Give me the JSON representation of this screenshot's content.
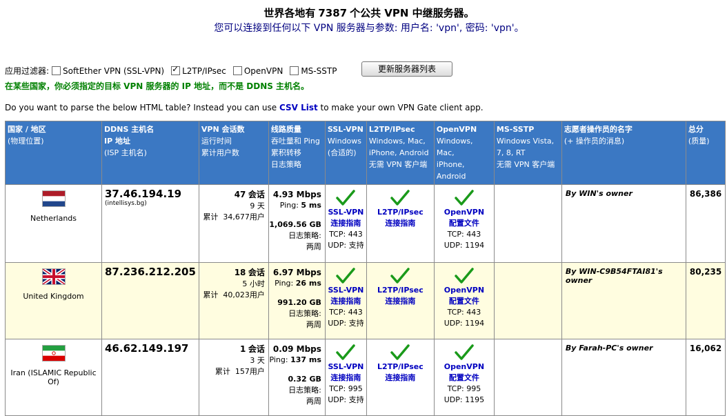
{
  "header": {
    "line1_pre": "世界各地有",
    "count": "7387",
    "line1_post": "个公共 VPN 中继服务器。",
    "line2_pre": "您可以连接到任何以下 VPN 服务器与参数: 用户名:",
    "user": "'vpn'",
    "line2_mid": ", 密码:",
    "pass": "'vpn'",
    "line2_end": "。"
  },
  "filters": {
    "label": "应用过滤器:",
    "options": [
      {
        "label": "SoftEther VPN (SSL-VPN)",
        "checked": false
      },
      {
        "label": "L2TP/IPsec",
        "checked": true
      },
      {
        "label": "OpenVPN",
        "checked": false
      },
      {
        "label": "MS-SSTP",
        "checked": false
      }
    ],
    "refresh_label": "更新服务器列表"
  },
  "warning": "在某些国家，你必须指定的目标 VPN 服务器的 IP 地址，而不是 DDNS 主机名。",
  "parse": {
    "pre": "Do you want to parse the below HTML table? Instead you can use",
    "link": "CSV List",
    "post": "to make your own VPN Gate client app."
  },
  "columns": [
    {
      "title": "国家 / 地区",
      "sub": [
        "(物理位置)"
      ]
    },
    {
      "title": "DDNS 主机名",
      "sub2": "IP 地址",
      "sub": [
        "(ISP 主机名)"
      ]
    },
    {
      "title": "VPN 会话数",
      "sub": [
        "运行时间",
        "累计用户数"
      ]
    },
    {
      "title": "线路质量",
      "sub": [
        "吞吐量和 Ping",
        "累积转移",
        "日志策略"
      ]
    },
    {
      "title": "SSL-VPN",
      "sub": [
        "Windows",
        "(合适的)"
      ]
    },
    {
      "title": "L2TP/IPsec",
      "sub": [
        "Windows, Mac,",
        "iPhone, Android",
        "无需 VPN 客户端"
      ]
    },
    {
      "title": "OpenVPN",
      "sub": [
        "Windows, Mac,",
        "iPhone, Android"
      ]
    },
    {
      "title": "MS-SSTP",
      "sub": [
        "Windows Vista,",
        "7, 8, RT",
        "无需 VPN 客户端"
      ]
    },
    {
      "title": "志愿者操作员的名字",
      "sub": [
        "(+ 操作员的消息)"
      ]
    },
    {
      "title": "总分",
      "sub": [
        "(质量)"
      ]
    }
  ],
  "labels": {
    "sessions_suffix": "会话",
    "cumulative": "累计",
    "users": "用户",
    "ping": "Ping:",
    "log_policy": "日志策略:",
    "ssl_link1": "SSL-VPN",
    "ssl_link2": "连接指南",
    "l2tp_link1": "L2TP/IPsec",
    "l2tp_link2": "连接指南",
    "ovpn_link1": "OpenVPN",
    "ovpn_link2": "配置文件"
  },
  "servers": [
    {
      "country": "Netherlands",
      "flag_colors": [
        "#ae1c28",
        "#ffffff",
        "#21468b"
      ],
      "ip": "37.46.194.19",
      "isp": "(intellisys.bg)",
      "sessions": "47",
      "uptime": "9 天",
      "cumulative": "34,677",
      "speed": "4.93 Mbps",
      "ping": "5 ms",
      "transfer": "1,069.56 GB",
      "log": "两周",
      "ssl_tcp": "TCP: 443",
      "ssl_udp": "UDP: 支持",
      "ovpn_tcp": "TCP: 443",
      "ovpn_udp": "UDP: 1194",
      "owner": "By WIN's owner",
      "score": "86,386"
    },
    {
      "country": "United Kingdom",
      "flag_colors": [
        "#012169",
        "#ffffff",
        "#c8102e"
      ],
      "ip": "87.236.212.205",
      "isp": "",
      "sessions": "18",
      "uptime": "5 小时",
      "cumulative": "40,023",
      "speed": "6.97 Mbps",
      "ping": "26 ms",
      "transfer": "991.20 GB",
      "log": "两周",
      "ssl_tcp": "TCP: 443",
      "ssl_udp": "UDP: 支持",
      "ovpn_tcp": "TCP: 443",
      "ovpn_udp": "UDP: 1194",
      "owner": "By WIN-C9B54FTAI81's owner",
      "score": "80,235"
    },
    {
      "country": "Iran (ISLAMIC Republic Of)",
      "flag_colors": [
        "#239f40",
        "#ffffff",
        "#da0000"
      ],
      "ip": "46.62.149.197",
      "isp": "",
      "sessions": "1",
      "uptime": "3 天",
      "cumulative": "157",
      "speed": "0.09 Mbps",
      "ping": "137 ms",
      "transfer": "0.32 GB",
      "log": "两周",
      "ssl_tcp": "TCP: 995",
      "ssl_udp": "UDP: 支持",
      "ovpn_tcp": "TCP: 995",
      "ovpn_udp": "UDP: 1195",
      "owner": "By Farah-PC's owner",
      "score": "16,062"
    }
  ]
}
